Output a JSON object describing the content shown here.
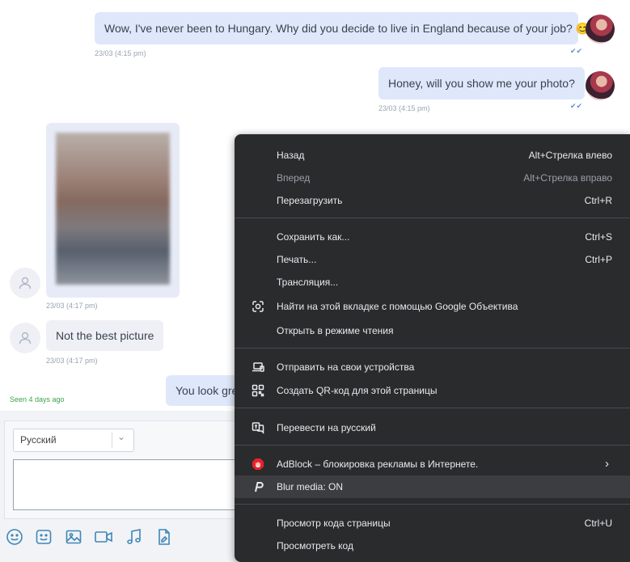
{
  "chat": {
    "messages": [
      {
        "text": "Wow, I've never been to Hungary. Why did you decide to live in England because of your job? 😊",
        "time": "23/03 (4:15 pm)"
      },
      {
        "text": "Honey, will you show me your photo?",
        "time": "23/03 (4:15 pm)"
      },
      {
        "time": "23/03 (4:17 pm)"
      },
      {
        "text": "Not the best picture",
        "time": "23/03 (4:17 pm)"
      },
      {
        "text": "You look gre"
      }
    ],
    "seen": "Seen 4 days ago",
    "check_mark": "✔✔"
  },
  "composer": {
    "language": "Русский",
    "chevron": "⌄",
    "tools": [
      "emoji-icon",
      "sticker-icon",
      "image-icon",
      "video-icon",
      "music-icon",
      "file-icon"
    ]
  },
  "context_menu": {
    "items": [
      {
        "label": "Назад",
        "shortcut": "Alt+Стрелка влево"
      },
      {
        "label": "Вперед",
        "shortcut": "Alt+Стрелка вправо",
        "disabled": true
      },
      {
        "label": "Перезагрузить",
        "shortcut": "Ctrl+R"
      },
      {
        "label": "Сохранить как...",
        "shortcut": "Ctrl+S"
      },
      {
        "label": "Печать...",
        "shortcut": "Ctrl+P"
      },
      {
        "label": "Трансляция..."
      },
      {
        "label": "Найти на этой вкладке с помощью Google Объектива",
        "icon": "google-lens-icon"
      },
      {
        "label": "Открыть в режиме чтения"
      },
      {
        "label": "Отправить на свои устройства",
        "icon": "send-to-devices-icon"
      },
      {
        "label": "Создать QR-код для этой страницы",
        "icon": "qr-code-icon"
      },
      {
        "label": "Перевести на русский",
        "icon": "translate-icon"
      },
      {
        "label": "AdBlock – блокировка рекламы в Интернете.",
        "icon": "adblock-icon",
        "submenu": "›"
      },
      {
        "label": "Blur media: ON",
        "icon": "blur-media-icon",
        "highlighted": true
      },
      {
        "label": "Просмотр кода страницы",
        "shortcut": "Ctrl+U"
      },
      {
        "label": "Просмотреть код"
      }
    ]
  },
  "colors": {
    "menu_bg": "#2a2b2d",
    "bubble_out": "#dfe8fa",
    "bubble_in": "#eef0f6",
    "seen_green": "#3aa54d",
    "adblock_red": "#e8222a",
    "tool_blue": "#3f86b8"
  }
}
